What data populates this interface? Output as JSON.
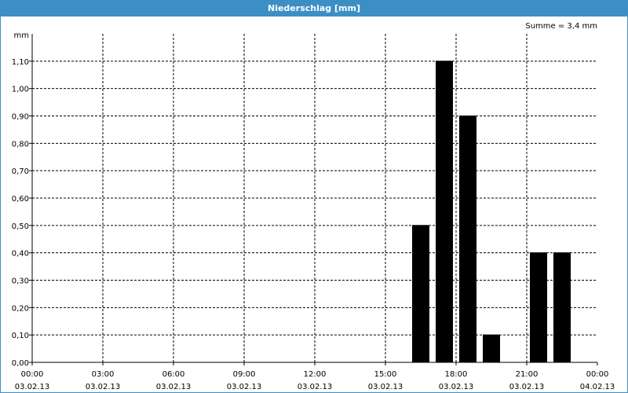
{
  "window": {
    "title": "Niederschlag [mm]"
  },
  "chart_data": {
    "type": "bar",
    "title": "Niederschlag [mm]",
    "ylabel": "mm",
    "summary": "Summe = 3,4 mm",
    "ylim": [
      0,
      1.2
    ],
    "y_ticks": [
      "0,00",
      "0,10",
      "0,20",
      "0,30",
      "0,40",
      "0,50",
      "0,60",
      "0,70",
      "0,80",
      "0,90",
      "1,00",
      "1,10"
    ],
    "x_ticks": [
      {
        "time": "00:00",
        "date": "03.02.13"
      },
      {
        "time": "03:00",
        "date": "03.02.13"
      },
      {
        "time": "06:00",
        "date": "03.02.13"
      },
      {
        "time": "09:00",
        "date": "03.02.13"
      },
      {
        "time": "12:00",
        "date": "03.02.13"
      },
      {
        "time": "15:00",
        "date": "03.02.13"
      },
      {
        "time": "18:00",
        "date": "03.02.13"
      },
      {
        "time": "21:00",
        "date": "03.02.13"
      },
      {
        "time": "00:00",
        "date": "04.02.13"
      }
    ],
    "bars": [
      {
        "time": "16:30",
        "value": 0.5
      },
      {
        "time": "17:30",
        "value": 1.1
      },
      {
        "time": "18:30",
        "value": 0.9
      },
      {
        "time": "19:30",
        "value": 0.1
      },
      {
        "time": "20:30",
        "value": 0.0
      },
      {
        "time": "21:30",
        "value": 0.4
      },
      {
        "time": "22:30",
        "value": 0.4
      }
    ],
    "bar_color": "#000000",
    "grid": true
  }
}
